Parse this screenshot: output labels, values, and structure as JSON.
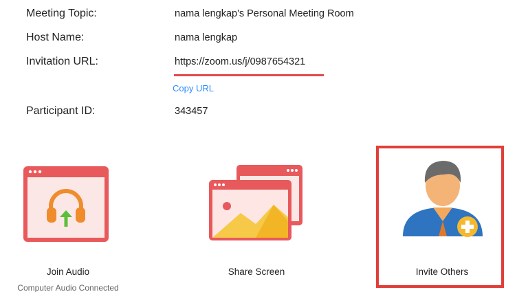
{
  "details": {
    "meeting_topic": {
      "label": "Meeting Topic:",
      "value": "nama lengkap's Personal Meeting Room"
    },
    "host_name": {
      "label": "Host Name:",
      "value": "nama lengkap"
    },
    "invitation_url": {
      "label": "Invitation URL:",
      "value": "https://zoom.us/j/0987654321"
    },
    "copy_url_label": "Copy URL",
    "participant_id": {
      "label": "Participant ID:",
      "value": "343457"
    }
  },
  "actions": {
    "join_audio": {
      "label": "Join Audio",
      "sublabel": "Computer Audio Connected",
      "icon": "headphones-icon"
    },
    "share_screen": {
      "label": "Share Screen",
      "icon": "share-screen-icon"
    },
    "invite_others": {
      "label": "Invite Others",
      "icon": "invite-person-icon"
    }
  },
  "colors": {
    "accent_red": "#e8595c",
    "link_blue": "#2d8cff",
    "highlight_red": "#e0403b",
    "headphones_orange": "#f08c2c",
    "arrow_green": "#5bbf3a",
    "person_blue": "#2f74c0",
    "plus_yellow": "#f5b92e"
  }
}
